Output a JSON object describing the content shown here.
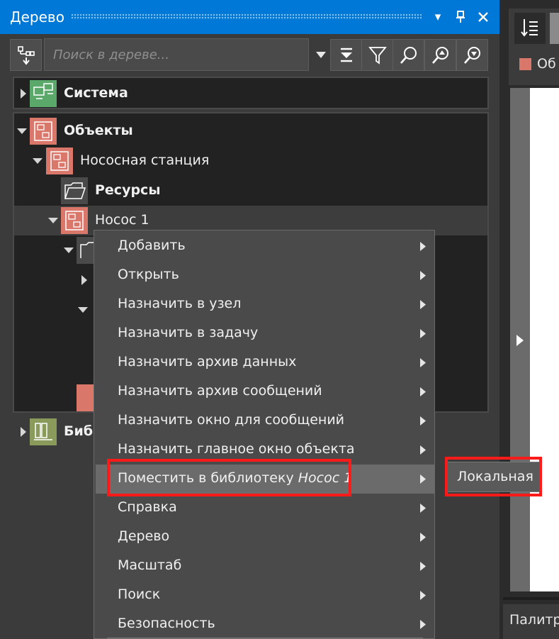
{
  "panel": {
    "title": "Дерево",
    "title_icons": [
      "chevron-down-icon",
      "pin-icon",
      "close-icon"
    ]
  },
  "toolbar": {
    "search_placeholder": "Поиск в дереве...",
    "buttons": [
      "tree-view-icon",
      "collapse-icon",
      "filter-icon",
      "search-icon",
      "find-up-icon",
      "find-down-icon"
    ]
  },
  "tree": {
    "system": "Система",
    "objects": "Объекты",
    "station": "Нососная станция",
    "resources": "Ресурсы",
    "pump": "Нococ 1",
    "library_partial": "Библ"
  },
  "menu": {
    "items": [
      {
        "label": "Добавить"
      },
      {
        "label": "Открыть"
      },
      {
        "label": "Назначить в узел"
      },
      {
        "label": "Назначить в задачу"
      },
      {
        "label": "Назначить архив данных"
      },
      {
        "label": "Назначить архив сообщений"
      },
      {
        "label": "Назначить окно для сообщений"
      },
      {
        "label": "Назначить главное окно объекта"
      },
      {
        "label": "Поместить в библиотеку",
        "italic": "Нococ 1"
      },
      {
        "label": "Справка"
      },
      {
        "label": "Дерево"
      },
      {
        "label": "Масштаб"
      },
      {
        "label": "Поиск"
      },
      {
        "label": "Безопасность"
      }
    ],
    "submenu_item": "Локальная"
  },
  "right": {
    "tab_partial": "Об",
    "palette_partial": "Палитр"
  },
  "colors": {
    "accent": "#0078d7",
    "object_icon": "#d9776a",
    "system_icon": "#5aa86a",
    "library_icon": "#8a9a5a",
    "highlight": "#ff1a1a"
  }
}
